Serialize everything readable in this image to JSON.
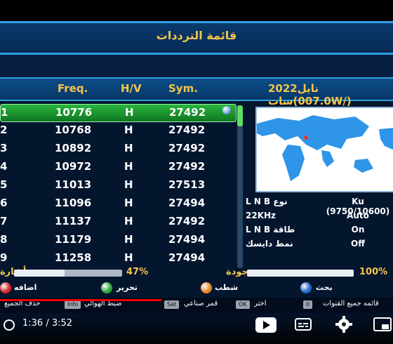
{
  "header": {
    "title": "قائمة الترددات"
  },
  "columns": {
    "freq": "Freq.",
    "hv": "H/V",
    "sym": "Sym.",
    "satellite": "2022نايل سات(007.0W/)"
  },
  "transponders": [
    {
      "idx": "1",
      "freq": "10776",
      "hv": "H",
      "sym": "27492",
      "selected": true
    },
    {
      "idx": "2",
      "freq": "10768",
      "hv": "H",
      "sym": "27492"
    },
    {
      "idx": "3",
      "freq": "10892",
      "hv": "H",
      "sym": "27492"
    },
    {
      "idx": "4",
      "freq": "10972",
      "hv": "H",
      "sym": "27492"
    },
    {
      "idx": "5",
      "freq": "11013",
      "hv": "H",
      "sym": "27513"
    },
    {
      "idx": "6",
      "freq": "11096",
      "hv": "H",
      "sym": "27494"
    },
    {
      "idx": "7",
      "freq": "11137",
      "hv": "H",
      "sym": "27492"
    },
    {
      "idx": "8",
      "freq": "11179",
      "hv": "H",
      "sym": "27494"
    },
    {
      "idx": "9",
      "freq": "11258",
      "hv": "H",
      "sym": "27494"
    }
  ],
  "info": [
    {
      "label": "L N B نوع",
      "value": "Ku (9750/10600)"
    },
    {
      "label": "22KHz",
      "value": "Auto"
    },
    {
      "label": "L N B طاقة",
      "value": "On"
    },
    {
      "label": "نمط دايسك",
      "value": "Off"
    }
  ],
  "signal": {
    "strength_label": "أشارة",
    "strength_value": "47%",
    "strength_fraction": 0.47,
    "quality_label": "جودة",
    "quality_value": "100%",
    "quality_fraction": 1.0
  },
  "color_buttons": [
    {
      "label": "اضافه",
      "color": "#d62828"
    },
    {
      "label": "تحرير",
      "color": "#2fa83a"
    },
    {
      "label": "شطب",
      "color": "#e2862a"
    },
    {
      "label": "بحث",
      "color": "#2367c9"
    }
  ],
  "hints": [
    {
      "text": "حذف الجميع"
    },
    {
      "key": "Info",
      "text": "ضبط الهوائي"
    },
    {
      "key": "Sat",
      "text": "قمر صناعي"
    },
    {
      "key": "OK",
      "text": "اختر"
    },
    {
      "key": "0",
      "text": "قائمه جميع القنوات"
    }
  ],
  "player": {
    "time": "1:36 / 3:52",
    "progress_fraction": 0.41
  },
  "icons": {
    "play": "play-icon",
    "captions": "captions-icon",
    "settings": "gear-icon",
    "miniplayer": "miniplayer-icon",
    "globe": "world-map"
  }
}
